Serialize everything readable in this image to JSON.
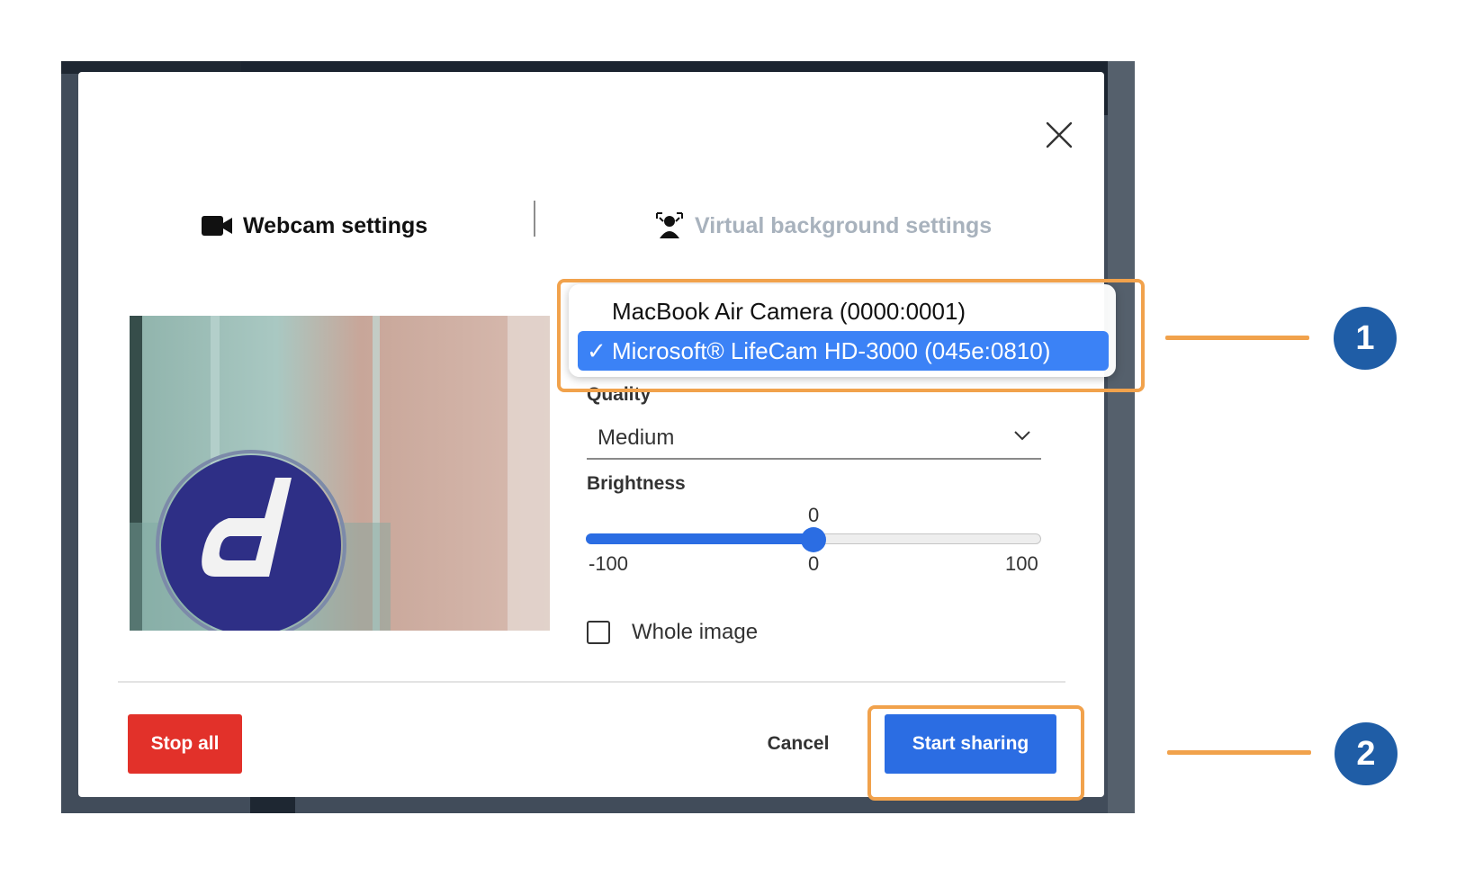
{
  "modal": {
    "tabs": {
      "webcam_label": "Webcam settings",
      "virtual_label": "Virtual background settings"
    },
    "quality": {
      "label": "Quality",
      "value": "Medium"
    },
    "brightness": {
      "label": "Brightness",
      "value": "0",
      "min_label": "-100",
      "mid_label": "0",
      "max_label": "100",
      "level_fraction": 0.5
    },
    "whole_image": {
      "label": "Whole image",
      "checked": false
    },
    "buttons": {
      "stop_all": "Stop all",
      "cancel": "Cancel",
      "start_sharing": "Start sharing"
    }
  },
  "camera_dropdown": {
    "options": [
      "MacBook Air Camera (0000:0001)",
      "Microsoft® LifeCam HD-3000 (045e:0810)"
    ],
    "selected_index": 1,
    "check_glyph": "✓"
  },
  "callouts": {
    "marker_1": "1",
    "marker_2": "2"
  },
  "colors": {
    "accent": "#2b6de3",
    "danger": "#e2312a",
    "callout": "#f1a24c",
    "marker": "#1f5da6",
    "selection": "#3b82f6"
  },
  "icons": {
    "close": "close-icon",
    "webcam": "video-camera-icon",
    "virtual_background": "person-background-icon",
    "chevron": "chevron-down-icon"
  }
}
